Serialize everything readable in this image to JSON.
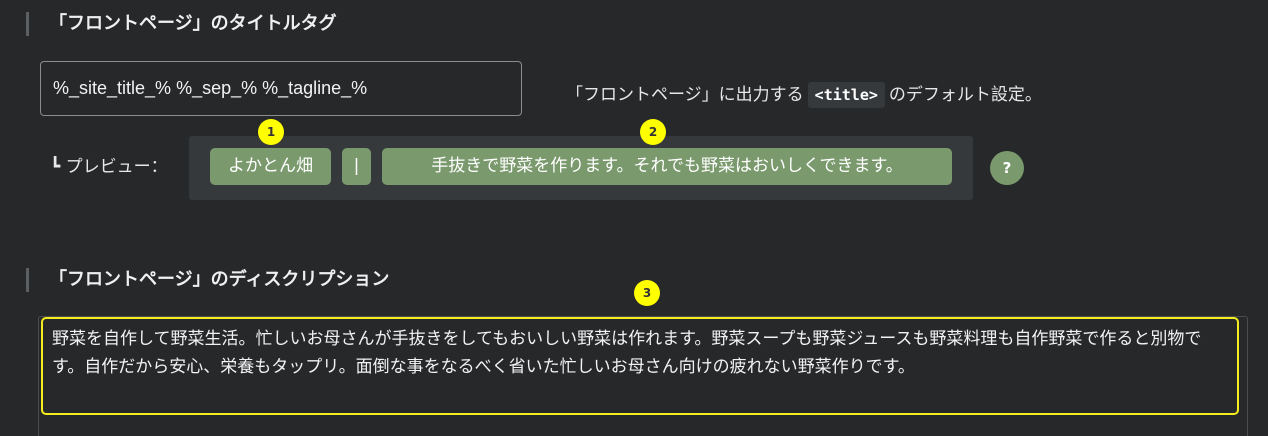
{
  "section1": {
    "title": "「フロントページ」のタイトルタグ",
    "input_value": "%_site_title_% %_sep_% %_tagline_%",
    "description_before": "「フロントページ」に出力する",
    "description_code": "<title>",
    "description_after": "のデフォルト設定。",
    "preview_label": "┗ プレビュー：",
    "preview": {
      "site_title": "よかとん畑",
      "separator": "|",
      "tagline": "手抜きで野菜を作ります。それでも野菜はおいしくできます。"
    },
    "help_icon_text": "?"
  },
  "section2": {
    "title": "「フロントページ」のディスクリプション",
    "textarea_value": "野菜を自作して野菜生活。忙しいお母さんが手抜きをしてもおいしい野菜は作れます。野菜スープも野菜ジュースも野菜料理も自作野菜で作ると別物です。自作だから安心、栄養もタップリ。面倒な事をなるべく省いた忙しいお母さん向けの疲れない野菜作りです。"
  },
  "markers": [
    "1",
    "2",
    "3"
  ],
  "colors": {
    "background": "#26282a",
    "chip": "#7a9a6e",
    "preview_box": "#36393c",
    "marker": "#ffff00",
    "highlight_border": "#f4ec1e"
  }
}
